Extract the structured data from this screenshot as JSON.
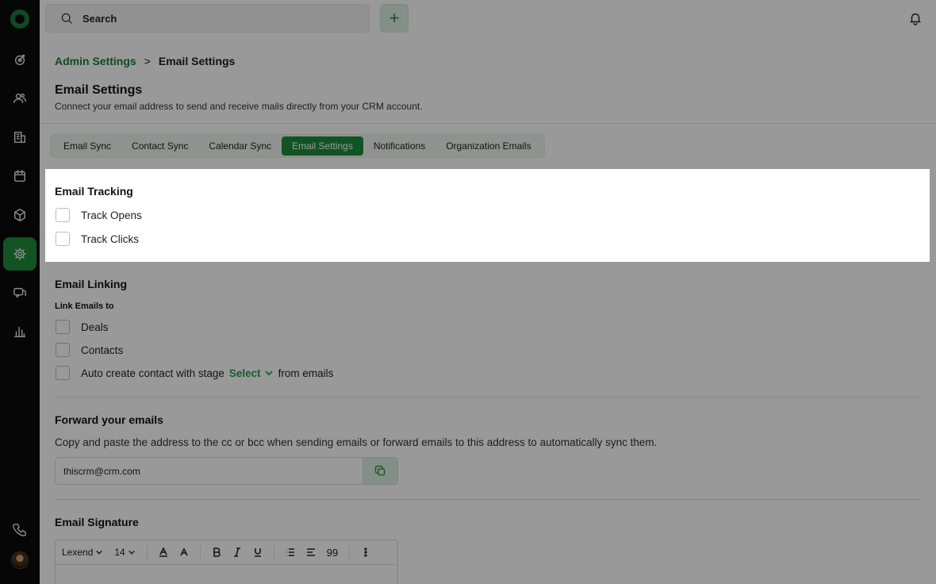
{
  "sidebar": {
    "items": [
      {
        "icon": "target-icon"
      },
      {
        "icon": "contacts-icon"
      },
      {
        "icon": "building-icon"
      },
      {
        "icon": "calendar-icon"
      },
      {
        "icon": "box-icon"
      },
      {
        "icon": "gear-icon",
        "active": true
      },
      {
        "icon": "chat-icon"
      },
      {
        "icon": "bar-chart-icon"
      }
    ],
    "bottom": [
      {
        "icon": "phone-icon"
      },
      {
        "icon": "avatar"
      }
    ]
  },
  "topbar": {
    "search_label": "Search",
    "add_label": "+"
  },
  "breadcrumb": {
    "parent": "Admin Settings",
    "separator": ">",
    "current": "Email Settings"
  },
  "page": {
    "title": "Email Settings",
    "description": "Connect your email address to send and receive mails directly from your CRM account."
  },
  "tabs": [
    {
      "label": "Email Sync"
    },
    {
      "label": "Contact Sync"
    },
    {
      "label": "Calendar Sync"
    },
    {
      "label": "Email Settings",
      "active": true
    },
    {
      "label": "Notifications"
    },
    {
      "label": "Organization Emails"
    }
  ],
  "tracking": {
    "title": "Email Tracking",
    "options": [
      {
        "label": "Track Opens",
        "checked": false
      },
      {
        "label": "Track Clicks",
        "checked": false
      }
    ]
  },
  "linking": {
    "title": "Email Linking",
    "sublabel": "Link Emails to",
    "options": [
      {
        "label": "Deals",
        "checked": false
      },
      {
        "label": "Contacts",
        "checked": false
      }
    ],
    "auto_create": {
      "prefix": "Auto create contact with stage",
      "select": "Select",
      "suffix": "from emails",
      "checked": false
    }
  },
  "forward": {
    "title": "Forward your emails",
    "description": "Copy and paste the address to the cc or bcc when sending emails or forward emails to this address to automatically sync them.",
    "address": "thiscrm@crm.com"
  },
  "signature": {
    "title": "Email Signature",
    "toolbar": {
      "font": "Lexend",
      "size": "14",
      "quote": "99"
    }
  },
  "colors": {
    "accent": "#1f8a3b",
    "link": "#1d7a34",
    "sidebar_bg": "#0b0b0b"
  }
}
